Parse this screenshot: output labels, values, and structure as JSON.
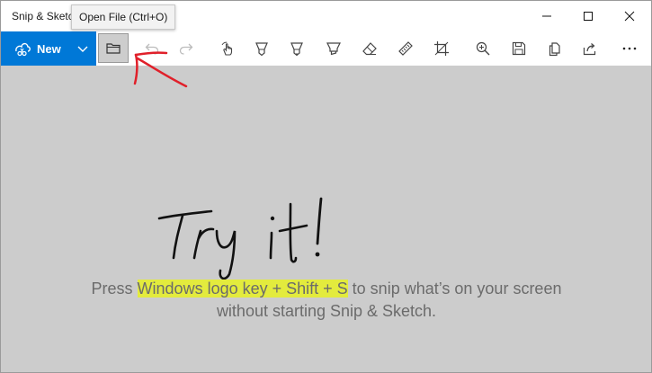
{
  "window": {
    "title": "Snip & Sketch",
    "controls": {
      "minimize": "minimize-icon",
      "maximize": "maximize-icon",
      "close": "close-icon"
    }
  },
  "tooltip": {
    "text": "Open File (Ctrl+O)"
  },
  "toolbar": {
    "new_label": "New",
    "accent": "#0078d7",
    "tools": [
      {
        "id": "undo",
        "icon": "undo-icon",
        "enabled": false
      },
      {
        "id": "redo",
        "icon": "redo-icon",
        "enabled": false
      },
      {
        "id": "touch-writing",
        "icon": "touch-writing-icon",
        "enabled": true
      },
      {
        "id": "ballpoint-pen",
        "icon": "ballpoint-pen-icon",
        "enabled": true
      },
      {
        "id": "pencil",
        "icon": "pencil-icon",
        "enabled": true
      },
      {
        "id": "highlighter",
        "icon": "highlighter-icon",
        "enabled": true
      },
      {
        "id": "eraser",
        "icon": "eraser-icon",
        "enabled": true
      },
      {
        "id": "ruler",
        "icon": "ruler-icon",
        "enabled": true
      },
      {
        "id": "crop",
        "icon": "crop-icon",
        "enabled": true
      },
      {
        "id": "zoom",
        "icon": "zoom-icon",
        "enabled": true
      },
      {
        "id": "save",
        "icon": "save-icon",
        "enabled": true
      },
      {
        "id": "copy",
        "icon": "copy-icon",
        "enabled": true
      },
      {
        "id": "share",
        "icon": "share-icon",
        "enabled": true
      },
      {
        "id": "more",
        "icon": "more-icon",
        "enabled": true
      }
    ]
  },
  "canvas": {
    "handwriting": "Try it!",
    "hint_before": "Press ",
    "hint_highlight": "Windows logo key + Shift + S",
    "hint_after": " to snip what’s on your screen without starting Snip & Sketch.",
    "ink_color": "#111111",
    "arrow_color": "#e0202a",
    "highlight_color": "#e3eb3d"
  }
}
